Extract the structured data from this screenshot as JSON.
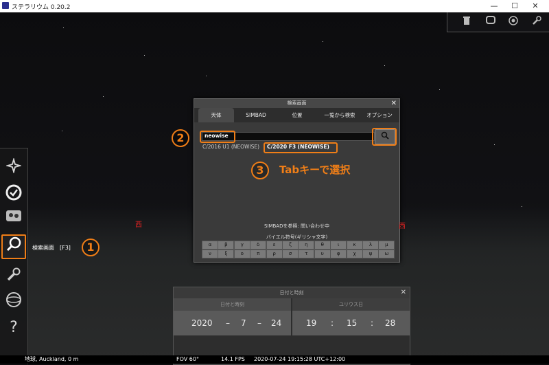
{
  "window": {
    "title": "ステラリウム 0.20.2",
    "minimize": "—",
    "maximize": "☐",
    "close": "✕"
  },
  "topright": {
    "icons": [
      "trash-icon",
      "tv-icon",
      "fisheye-icon",
      "wrench-icon"
    ]
  },
  "leftbar": {
    "icons": [
      "sky-settings-icon",
      "clock-icon",
      "location-icon",
      "search-icon",
      "config-icon",
      "help-icon"
    ],
    "tooltip": "検索画面　[F3]"
  },
  "callouts": {
    "one": "1",
    "two": "2",
    "three": "3",
    "three_text": "Tabキーで選択"
  },
  "dialog": {
    "title": "検索画面",
    "close": "✕",
    "tabs": [
      "天体",
      "SIMBAD",
      "位置",
      "一覧から検索",
      "オプション"
    ],
    "search_value": "neowise",
    "results": [
      "C/2016 U1 (NEOWISE)",
      "C/2020 F3 (NEOWISE)"
    ],
    "simbad_status": "SIMBADを参照: 問い合わせ中",
    "greek_title": "バイエル符号(ギリシャ文字)",
    "greek": [
      "α",
      "β",
      "γ",
      "δ",
      "ε",
      "ζ",
      "η",
      "θ",
      "ι",
      "κ",
      "λ",
      "μ",
      "ν",
      "ξ",
      "ο",
      "π",
      "ρ",
      "σ",
      "τ",
      "υ",
      "φ",
      "χ",
      "ψ",
      "ω"
    ]
  },
  "cardinal": {
    "west": "西",
    "west2": "西"
  },
  "datetime": {
    "title": "日付と時刻",
    "close": "✕",
    "tab_left": "日付と時刻",
    "tab_right": "ユリウス日",
    "year": "2020",
    "month": "7",
    "day": "24",
    "hour": "19",
    "minute": "15",
    "second": "28",
    "dash": "–",
    "colon": ":"
  },
  "bottombar": {
    "location": "地球, Auckland, 0 m",
    "fov": "FOV 60°",
    "fps": "14.1 FPS",
    "datetime": "2020-07-24 19:15:28 UTC+12:00"
  },
  "colors": {
    "accent": "#f07e17",
    "cardinal": "#dd2222"
  }
}
